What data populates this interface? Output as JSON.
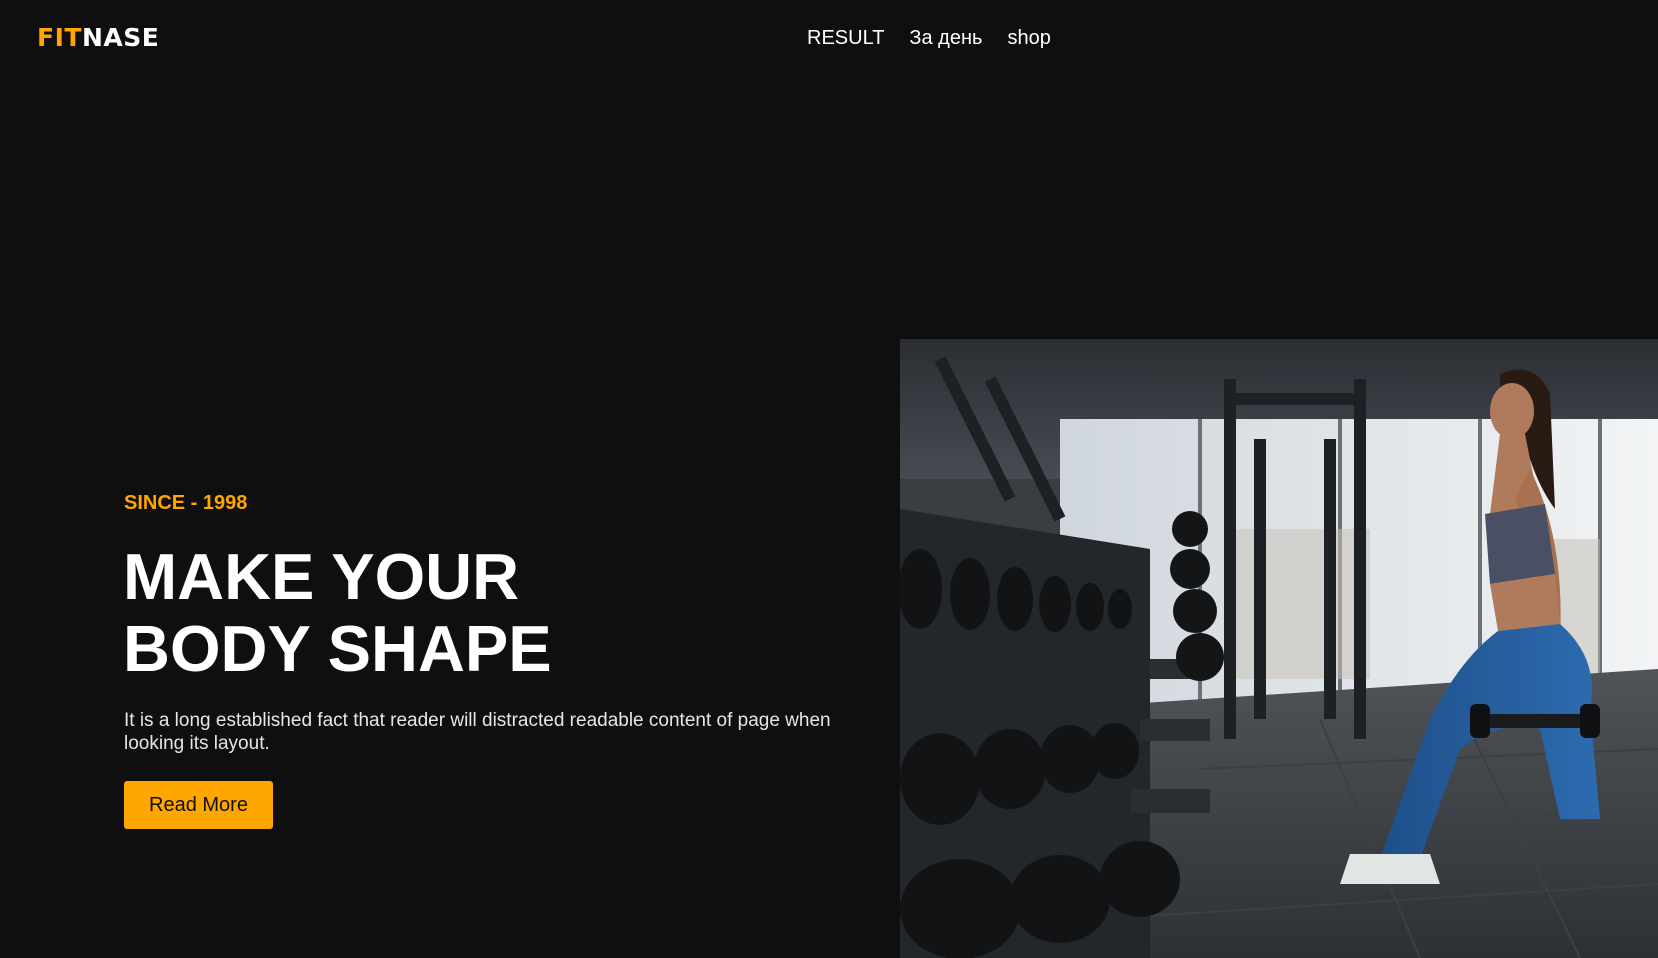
{
  "logo": {
    "part1": "FIT",
    "part2": "NASE"
  },
  "nav": {
    "items": [
      {
        "label": "RESULT"
      },
      {
        "label": "За день"
      },
      {
        "label": "shop"
      }
    ]
  },
  "hero": {
    "tagline": "SINCE - 1998",
    "headline_line1": "MAKE YOUR",
    "headline_line2": "BODY SHAPE",
    "description": "It is a long established fact that reader will distracted readable content of page when looking its layout.",
    "cta_label": "Read More"
  },
  "colors": {
    "background": "#0f0f0f",
    "accent": "#ffa600",
    "text": "#ffffff"
  },
  "image": {
    "subject": "woman doing dumbbell lunges in a gym next to dumbbell racks"
  }
}
